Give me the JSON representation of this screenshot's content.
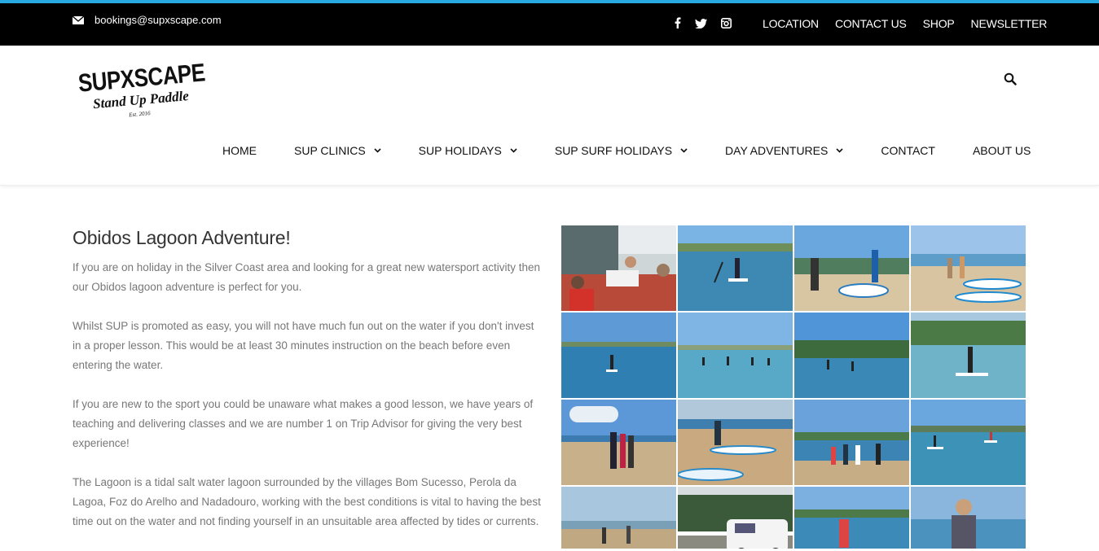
{
  "topbar": {
    "email": "bookings@supxscape.com",
    "social": [
      "facebook-icon",
      "twitter-icon",
      "instagram-icon"
    ],
    "links": [
      "LOCATION",
      "CONTACT US",
      "SHOP",
      "NEWSLETTER"
    ]
  },
  "logo": {
    "wordmark": "SUPXSCAPE",
    "tagline": "Stand Up Paddle",
    "est": "Est. 2016"
  },
  "nav": {
    "items": [
      {
        "label": "HOME",
        "dropdown": false
      },
      {
        "label": "SUP CLINICS",
        "dropdown": true
      },
      {
        "label": "SUP HOLIDAYS",
        "dropdown": true
      },
      {
        "label": "SUP SURF HOLIDAYS",
        "dropdown": true
      },
      {
        "label": "DAY ADVENTURES",
        "dropdown": true
      },
      {
        "label": "CONTACT",
        "dropdown": false
      },
      {
        "label": "ABOUT US",
        "dropdown": false
      }
    ]
  },
  "article": {
    "title": "Obidos Lagoon Adventure!",
    "paragraphs": [
      "If you are on holiday in the Silver Coast area and looking for a great new watersport activity then our Obidos lagoon adventure is perfect for you.",
      "Whilst SUP is promoted as easy, you will not have much fun out on the water if you don't invest in a proper lesson.  This would be at least 30 minutes instruction on the beach before even entering the water.",
      "If you are new to the sport you could be unaware what makes a good lesson, we have years of teaching and  delivering classes and we are number 1 on Trip Advisor for giving the very best experience!",
      "The Lagoon is a tidal salt water lagoon surrounded by the villages Bom Sucesso, Perola da Lagoa, Foz do Arelho and Nadadouro, working with the best conditions is vital to having the best time out on the water and not finding yourself in an unsuitable area affected by tides or currents."
    ]
  },
  "gallery": {
    "photos": [
      "cafe-group-photo",
      "paddler-on-lagoon-photo",
      "beach-group-with-boards-photo",
      "boards-on-sand-photo",
      "paddler-distant-photo",
      "group-paddling-photo",
      "paddlers-near-shore-photo",
      "paddler-on-board-photo",
      "beach-group-with-paddles-photo",
      "boards-on-beach-photo",
      "group-on-shoreline-photo",
      "paddlers-on-water-photo",
      "beach-people-photo",
      "van-photo",
      "woman-on-board-photo",
      "man-portrait-photo"
    ]
  },
  "colors": {
    "accent": "#29a9e1",
    "topbar": "#000000",
    "text": "#777777",
    "title": "#333333"
  }
}
